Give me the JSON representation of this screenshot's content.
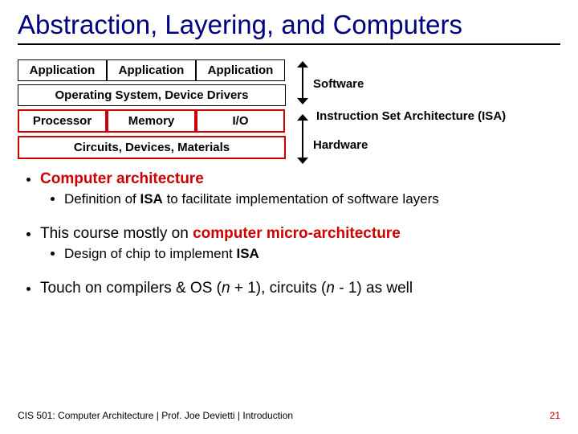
{
  "title": "Abstraction, Layering, and Computers",
  "diagram": {
    "apps": [
      "Application",
      "Application",
      "Application"
    ],
    "os": "Operating System, Device Drivers",
    "hw_row": [
      "Processor",
      "Memory",
      "I/O"
    ],
    "bottom": "Circuits, Devices, Materials",
    "labels": {
      "software": "Software",
      "isa": "Instruction Set Architecture (ISA)",
      "hardware": "Hardware"
    }
  },
  "bullets": {
    "b1": "Computer architecture",
    "b1a_pre": "Definition of ",
    "b1a_bold": "ISA",
    "b1a_post": " to facilitate implementation of software layers",
    "b2_pre": "This course mostly on ",
    "b2_bold": "computer micro-architecture",
    "b2a_pre": "Design of chip to implement ",
    "b2a_bold": "ISA",
    "b3_pre": "Touch on compilers & OS (",
    "b3_n1": "n",
    "b3_mid": " + 1), circuits (",
    "b3_n2": "n",
    "b3_post": " - 1) as well"
  },
  "footer": {
    "left": "CIS 501: Computer Architecture  |  Prof. Joe Devietti  |  Introduction",
    "page": "21"
  }
}
